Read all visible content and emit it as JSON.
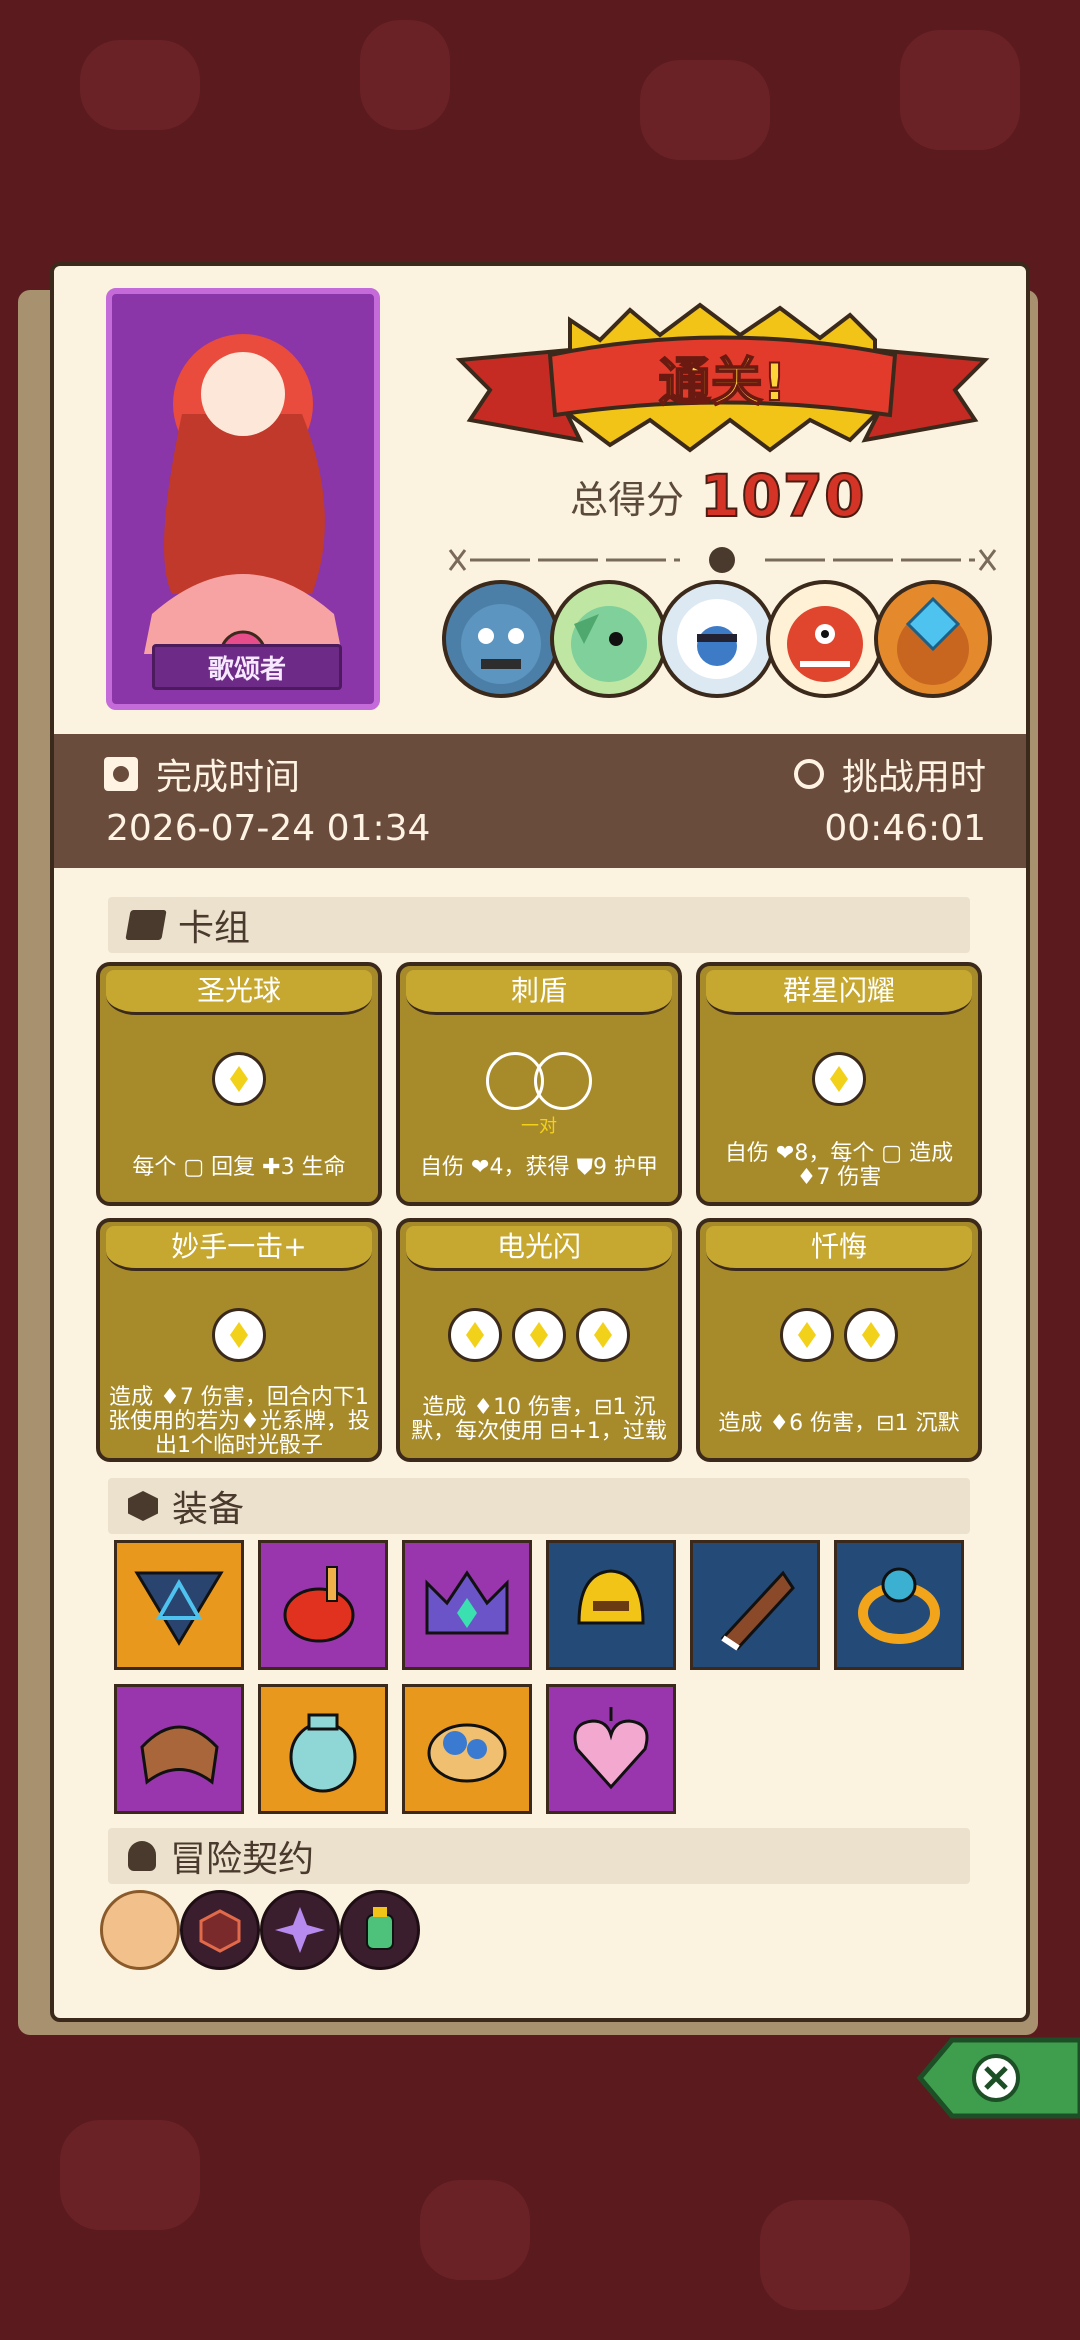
{
  "character": {
    "name": "歌颂者"
  },
  "result": {
    "banner": "通关!",
    "score_label": "总得分",
    "score": "1070"
  },
  "bosses": [
    "blue-ogre",
    "green-goblin",
    "blue-beast",
    "red-demon-mask",
    "gem-golem"
  ],
  "stats": {
    "completion_label": "完成时间",
    "completion_value": "2026-07-24 01:34",
    "duration_label": "挑战用时",
    "duration_value": "00:46:01"
  },
  "sections": {
    "deck": "卡组",
    "equipment": "装备",
    "contract": "冒险契约"
  },
  "cards": [
    {
      "title": "圣光球",
      "desc": "每个 ▢ 回复 ✚3 生命"
    },
    {
      "title": "刺盾",
      "sub": "一对",
      "desc": "自伤 ❤4，获得 ⛊9 护甲"
    },
    {
      "title": "群星闪耀",
      "desc": "自伤 ❤8，每个 ▢ 造成 ♦7 伤害"
    },
    {
      "title": "妙手一击+",
      "desc": "造成 ♦7 伤害，回合内下1张使用的若为♦光系牌，投出1个临时光骰子"
    },
    {
      "title": "电光闪",
      "desc": "造成 ♦10 伤害，⊟1 沉默，每次使用 ⊟+1，过载"
    },
    {
      "title": "忏悔",
      "desc": "造成 ♦6 伤害，⊟1 沉默"
    }
  ],
  "equipment": [
    "triangle-rune",
    "red-pepper",
    "purple-crown",
    "gold-helmet",
    "horn",
    "emerald-ring",
    "leather-bracer",
    "teal-vase",
    "bread",
    "heart-locket"
  ],
  "contracts": [
    "scroll",
    "dark-cube",
    "purple-star",
    "green-potion"
  ],
  "colors": {
    "score": "#d33425",
    "paper": "#fbf3df",
    "card": "#a78b2b"
  }
}
